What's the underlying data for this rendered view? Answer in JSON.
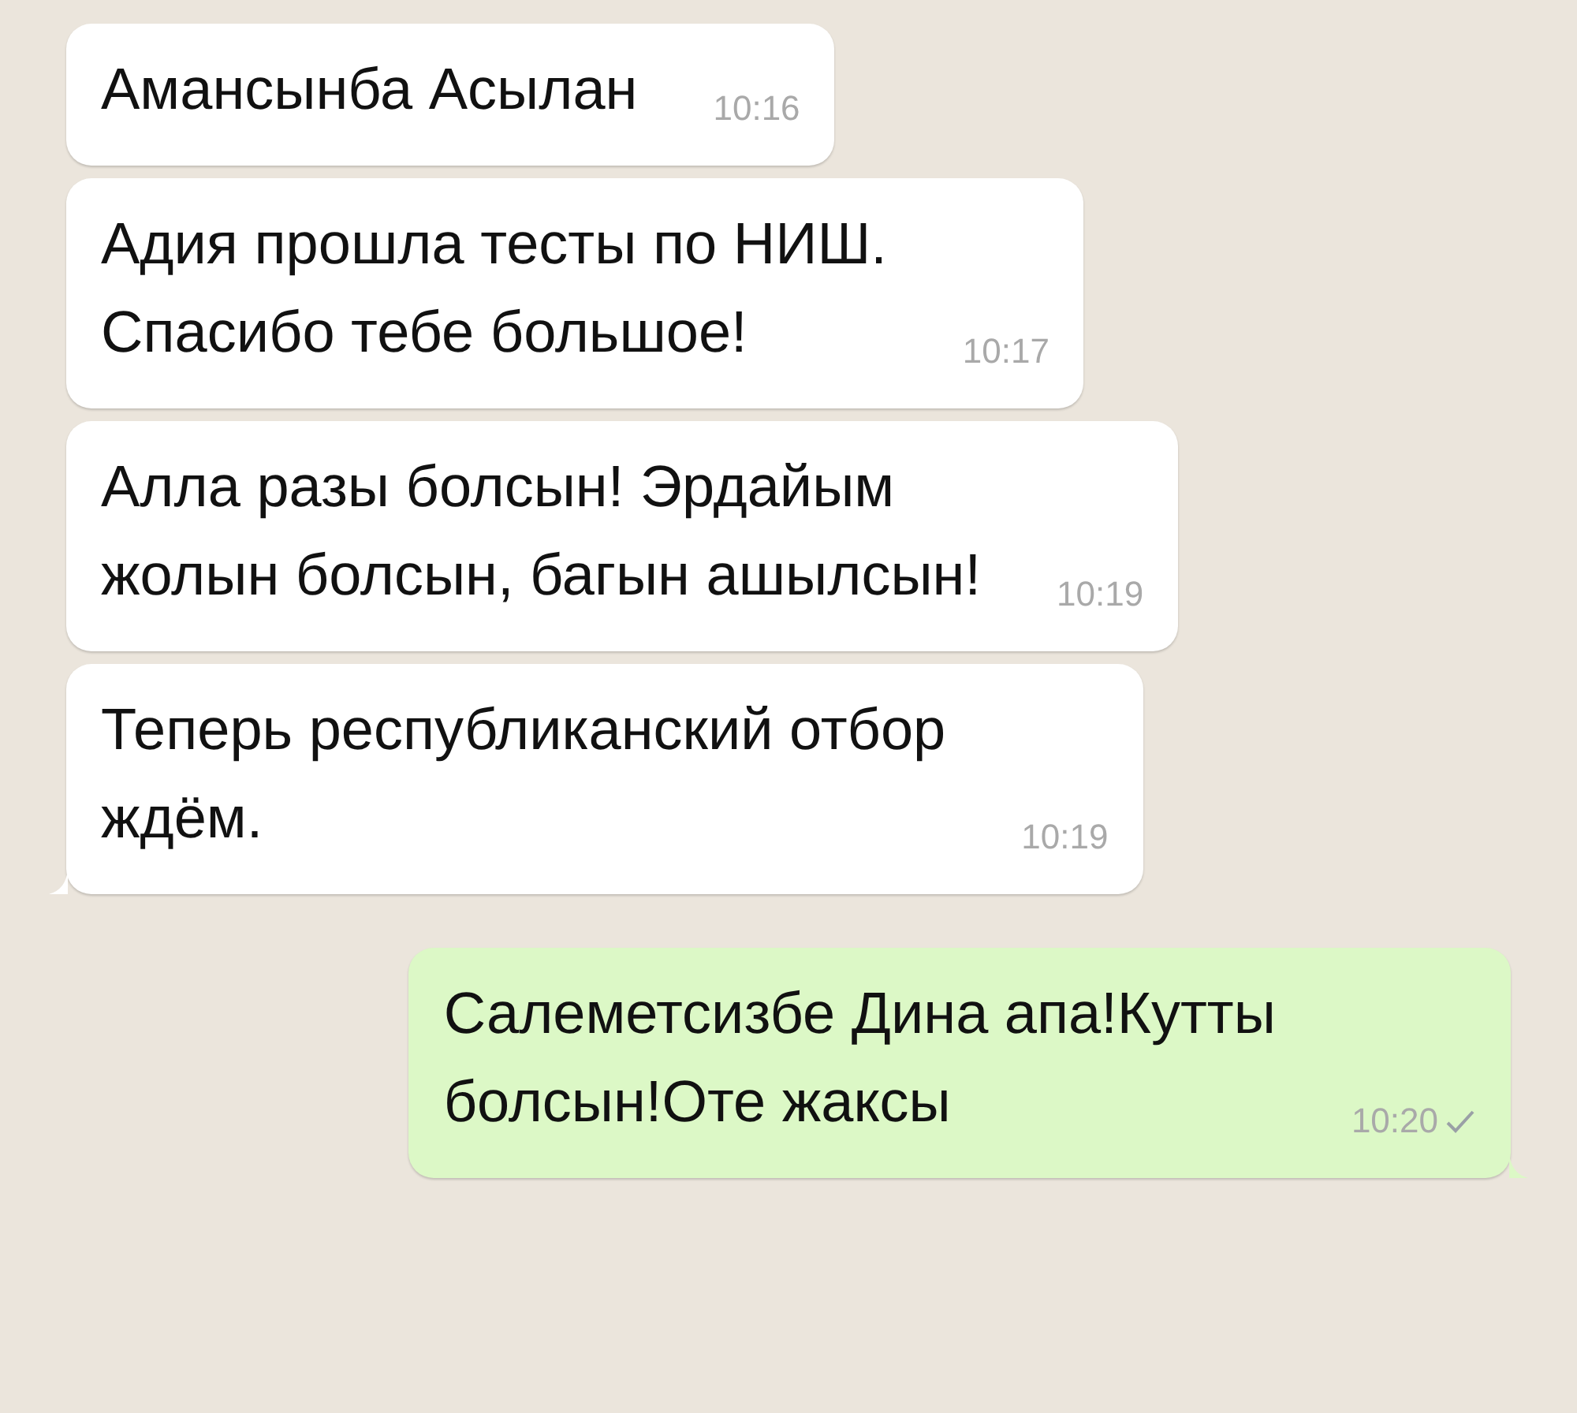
{
  "messages": [
    {
      "kind": "incoming",
      "text": "Амансынба Асылан",
      "time": "10:16",
      "tail": false
    },
    {
      "kind": "incoming",
      "text": "Адия прошла тесты по НИШ.\nСпасибо тебе большое!",
      "time": "10:17",
      "tail": false
    },
    {
      "kind": "incoming",
      "text": "Алла разы болсын! Эрдайым\nжолын болсын, багын ашылсын!",
      "time": "10:19",
      "tail": false
    },
    {
      "kind": "incoming",
      "text": "Теперь республиканский отбор\nждём.",
      "time": "10:19",
      "tail": true
    },
    {
      "kind": "outgoing",
      "text": "Салеметсизбе Дина апа!Кутты\nболсын!Оте жаксы",
      "time": "10:20",
      "tail": true,
      "read": false
    }
  ]
}
